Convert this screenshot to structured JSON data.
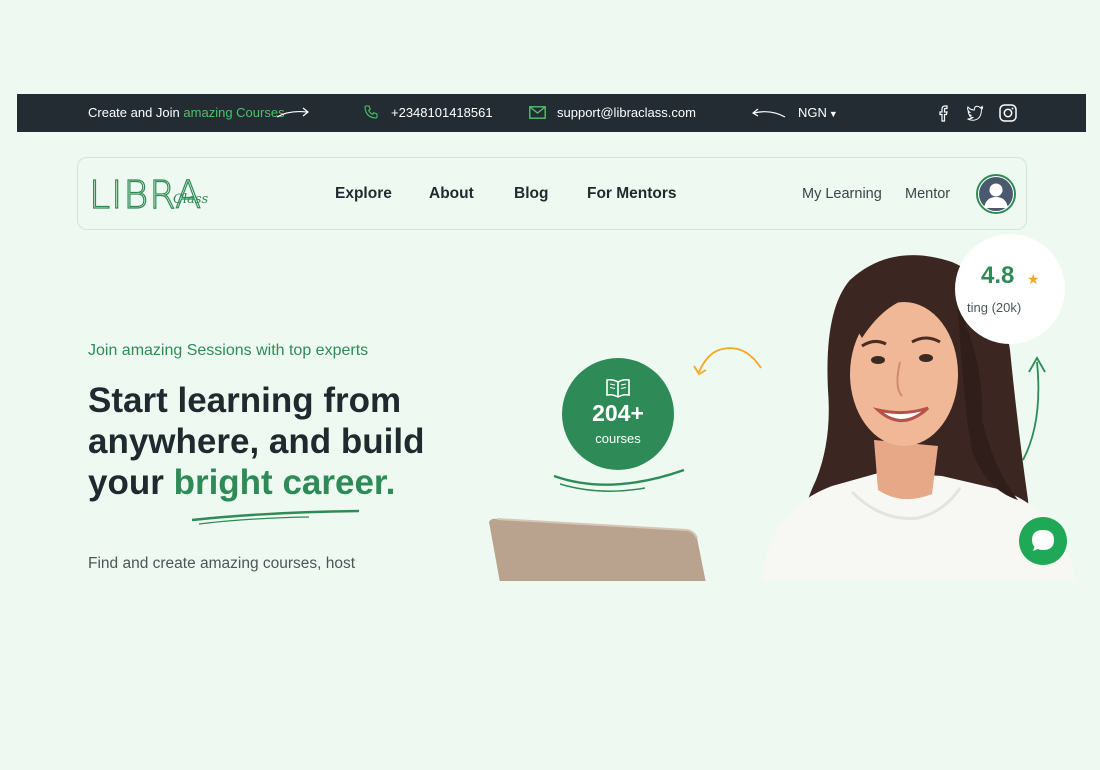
{
  "colors": {
    "topbar_bg": "#232b33",
    "accent_green": "#2e8b57",
    "bright_green": "#4cc36a",
    "star": "#f5a623",
    "page_bg": "#eefaf1"
  },
  "topbar": {
    "promo_prefix": "Create and Join ",
    "promo_accent": "amazing Courses",
    "phone": "+2348101418561",
    "email": "support@libraclass.com",
    "currency": "NGN",
    "social_icons": [
      "facebook-icon",
      "twitter-icon",
      "instagram-icon"
    ]
  },
  "logo": {
    "main": "LIBRA",
    "script": "Class"
  },
  "nav": {
    "links": [
      "Explore",
      "About",
      "Blog",
      "For Mentors"
    ],
    "right": [
      "My Learning",
      "Mentor"
    ]
  },
  "hero": {
    "kicker": "Join amazing Sessions with top experts",
    "title_plain": "Start learning from anywhere, and build your ",
    "title_accent": "bright career.",
    "description": "Find and create amazing courses, host"
  },
  "courses_badge": {
    "count": "204+",
    "label": "courses",
    "icon": "open-book-icon"
  },
  "rating": {
    "value": "4.8",
    "label": "ting (20k)",
    "icon": "star-icon"
  },
  "chat": {
    "icon": "chat-bubble-icon"
  }
}
